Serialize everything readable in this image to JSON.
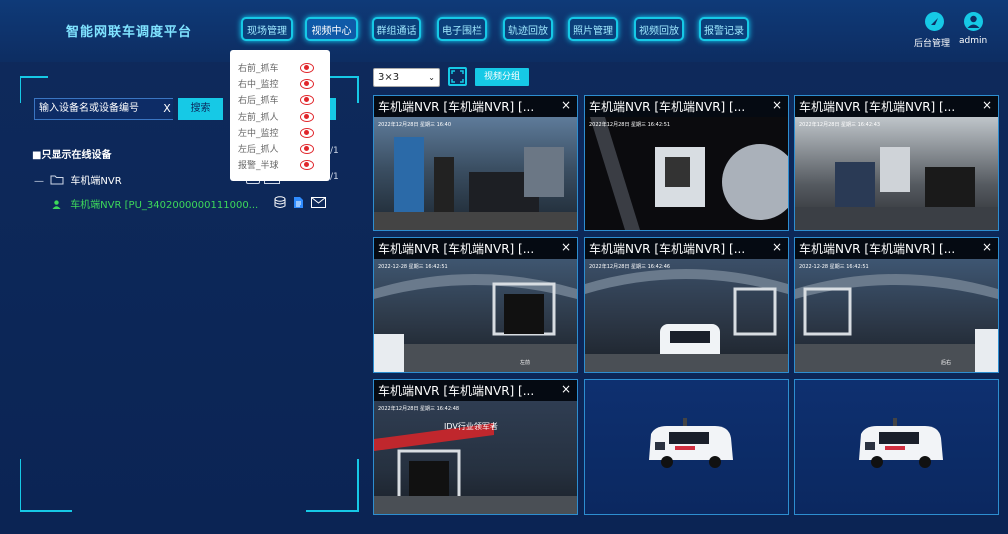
{
  "header": {
    "title": "智能网联车调度平台",
    "nav": [
      "现场管理",
      "视频中心",
      "群组通话",
      "电子围栏",
      "轨迹回放",
      "照片管理",
      "视频回放",
      "报警记录"
    ],
    "active_nav": "视频中心",
    "backend_label": "后台管理",
    "user_label": "admin",
    "accent_color": "#16c9e6"
  },
  "left_panel": {
    "search_placeholder": "输入设备名或设备编号",
    "clear_label": "X",
    "search_label": "搜索",
    "online_only_label": "只显示在线设备",
    "online_count": "/1",
    "tree": {
      "group_label": "车机端NVR",
      "group_count": "/1",
      "device_label": "车机端NVR [PU_3402000000111000..."
    }
  },
  "channel_menu": {
    "items": [
      "右前_抓车",
      "右中_监控",
      "右后_抓车",
      "左前_抓人",
      "左中_监控",
      "左后_抓人",
      "报警_半球"
    ]
  },
  "toolbar": {
    "grid_value": "3×3",
    "group_button": "视频分组"
  },
  "tiles": [
    {
      "title": "车机端NVR [车机端NVR] [...",
      "close": "×",
      "timestamp": "2022年12月28日 星期三 16:40"
    },
    {
      "title": "车机端NVR [车机端NVR] [...",
      "close": "×",
      "timestamp": "2022年12月28日 星期三 16:42:51"
    },
    {
      "title": "车机端NVR [车机端NVR] [...",
      "close": "×",
      "timestamp": "2022年12月28日 星期三 16:42:43"
    },
    {
      "title": "车机端NVR [车机端NVR] [...",
      "close": "×",
      "timestamp": "2022-12-28 星期三 16:42:51",
      "label": "左前"
    },
    {
      "title": "车机端NVR [车机端NVR] [...",
      "close": "×",
      "timestamp": "2022年12月28日 星期三 16:42:46"
    },
    {
      "title": "车机端NVR [车机端NVR] [...",
      "close": "×",
      "timestamp": "2022-12-28 星期三 16:42:51",
      "label": "后右"
    },
    {
      "title": "车机端NVR [车机端NVR] [...",
      "close": "×",
      "timestamp": "2022年12月28日 星期三 16:42:48",
      "banner": "IDV行业领军者"
    }
  ]
}
